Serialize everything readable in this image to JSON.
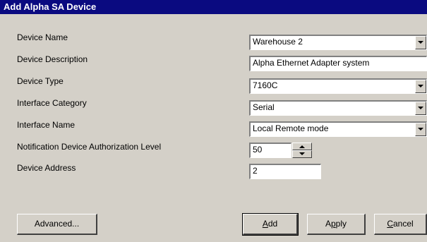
{
  "window": {
    "title": "Add Alpha SA Device"
  },
  "fields": [
    {
      "label": "Device Name",
      "value": "Warehouse 2",
      "type": "combo"
    },
    {
      "label": "Device Description",
      "value": "Alpha Ethernet Adapter system",
      "type": "text"
    },
    {
      "label": "Device Type",
      "value": "7160C",
      "type": "combo"
    },
    {
      "label": "Interface Category",
      "value": "Serial",
      "type": "combo"
    },
    {
      "label": "Interface Name",
      "value": "Local Remote mode",
      "type": "combo"
    },
    {
      "label": "Notification Device Authorization Level",
      "value": "50",
      "type": "spinner"
    },
    {
      "label": "Device Address",
      "value": "2",
      "type": "text"
    }
  ],
  "buttons": {
    "advanced": "Advanced...",
    "add": {
      "pre": "",
      "mnemonic": "A",
      "post": "dd"
    },
    "apply": {
      "pre": "A",
      "mnemonic": "p",
      "post": "ply"
    },
    "cancel": {
      "pre": "",
      "mnemonic": "C",
      "post": "ancel"
    }
  }
}
